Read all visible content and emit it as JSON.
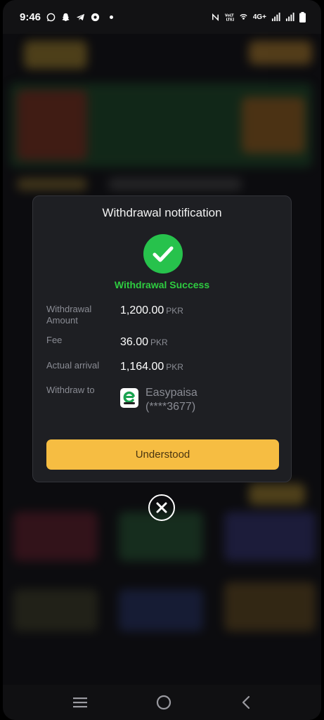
{
  "status_bar": {
    "time": "9:46",
    "network": "4G+"
  },
  "modal": {
    "title": "Withdrawal notification",
    "status": "Withdrawal Success",
    "rows": {
      "amount_label": "Withdrawal Amount",
      "amount_value": "1,200.00",
      "fee_label": "Fee",
      "fee_value": "36.00",
      "arrival_label": "Actual arrival",
      "arrival_value": "1,164.00",
      "currency": "PKR",
      "withdraw_to_label": "Withdraw to",
      "method_name": "Easypaisa",
      "method_account": "(****3677)"
    },
    "button_label": "Understood"
  },
  "colors": {
    "accent": "#f6bd42",
    "success": "#2ecc40",
    "modal_bg": "#1e1f23"
  },
  "icons": {
    "success": "check-icon",
    "close": "close-circle-icon",
    "wallet": "easypaisa-logo"
  }
}
